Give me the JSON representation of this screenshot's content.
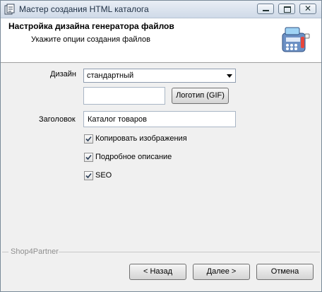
{
  "window": {
    "title": "Мастер создания HTML каталога",
    "close_glyph": "✕"
  },
  "header": {
    "title": "Настройка дизайна генератора файлов",
    "subtitle": "Укажите опции создания файлов",
    "icon": "cash-register-icon"
  },
  "form": {
    "design_label": "Дизайн",
    "design_value": "стандартный",
    "logo_path_value": "",
    "logo_button": "Логотип (GIF)",
    "heading_label": "Заголовок",
    "heading_value": "Каталог товаров",
    "checkboxes": [
      {
        "label": "Копировать изображения",
        "checked": true
      },
      {
        "label": "Подробное описание",
        "checked": true
      },
      {
        "label": "SEO",
        "checked": true
      }
    ]
  },
  "footer": {
    "brand": "Shop4Partner",
    "back": "< Назад",
    "next": "Далее >",
    "cancel": "Отмена"
  }
}
